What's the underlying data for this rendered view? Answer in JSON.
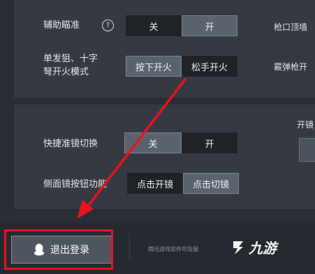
{
  "settings": {
    "aim_assist": {
      "label": "辅助瞄准",
      "options": [
        "关",
        "开"
      ],
      "selected": 1
    },
    "fire_mode": {
      "label_line1": "单发狙、十字",
      "label_line2": "弩开火模式",
      "options": [
        "按下开火",
        "松手开火"
      ],
      "selected": 0
    },
    "scope_switch": {
      "label": "快捷准镜切换",
      "options": [
        "关",
        "开"
      ],
      "selected": 0
    },
    "side_scope": {
      "label": "侧面镜按钮功能",
      "options": [
        "点击开镜",
        "点击切镜"
      ],
      "selected": 1
    }
  },
  "right_column": {
    "muzzle": "枪口顶墙",
    "shotgun": "霰弹枪开",
    "scope": "开镜"
  },
  "logout": {
    "label": "退出登录"
  },
  "footer_note": "腾讯游戏软件可及服",
  "watermark": {
    "text": "九游"
  },
  "colors": {
    "highlight": "#e8131f",
    "arrow": "#e8131f"
  }
}
